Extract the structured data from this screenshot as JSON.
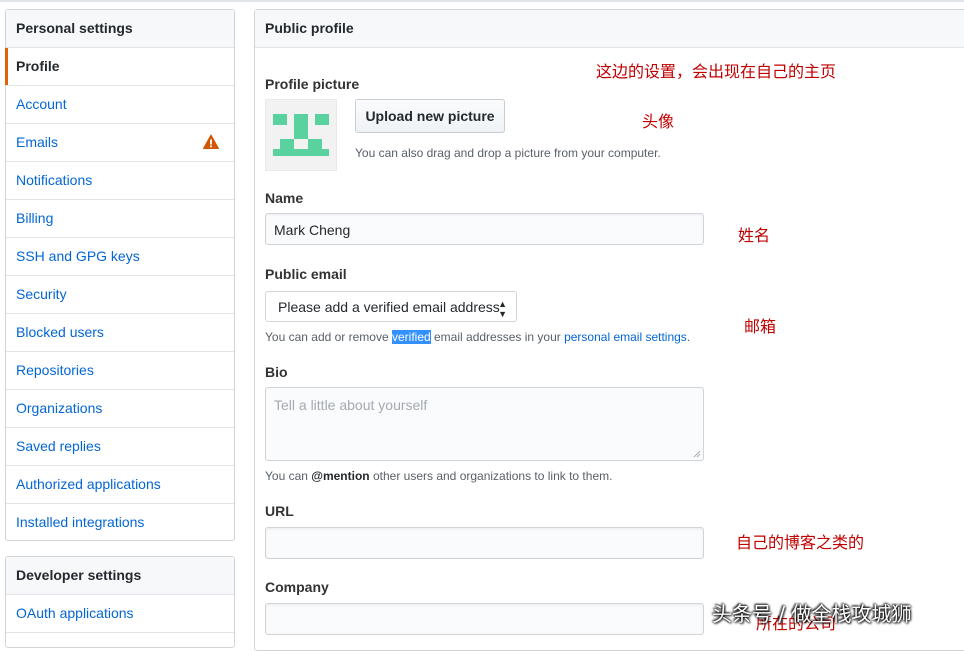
{
  "sidebar": {
    "title": "Personal settings",
    "items": [
      {
        "label": "Profile",
        "selected": true
      },
      {
        "label": "Account"
      },
      {
        "label": "Emails",
        "icon": "warning-icon"
      },
      {
        "label": "Notifications"
      },
      {
        "label": "Billing"
      },
      {
        "label": "SSH and GPG keys"
      },
      {
        "label": "Security"
      },
      {
        "label": "Blocked users"
      },
      {
        "label": "Repositories"
      },
      {
        "label": "Organizations"
      },
      {
        "label": "Saved replies"
      },
      {
        "label": "Authorized applications"
      },
      {
        "label": "Installed integrations"
      }
    ]
  },
  "developer": {
    "title": "Developer settings",
    "items": [
      {
        "label": "OAuth applications"
      }
    ]
  },
  "main": {
    "title": "Public profile",
    "picture": {
      "label": "Profile picture",
      "button": "Upload new picture",
      "note": "You can also drag and drop a picture from your computer."
    },
    "name": {
      "label": "Name",
      "value": "Mark Cheng"
    },
    "email": {
      "label": "Public email",
      "selected": "Please add a verified email address",
      "note_pre": "You can add or remove ",
      "note_hl": "verified",
      "note_mid": " email addresses in your ",
      "note_link": "personal email settings",
      "note_end": "."
    },
    "bio": {
      "label": "Bio",
      "placeholder": "Tell a little about yourself",
      "note_pre": "You can ",
      "note_bold": "@mention",
      "note_post": " other users and organizations to link to them."
    },
    "url": {
      "label": "URL",
      "value": ""
    },
    "company": {
      "label": "Company",
      "value": ""
    }
  },
  "annotations": {
    "top": "这边的设置，会出现在自己的主页",
    "avatar": "头像",
    "name": "姓名",
    "email": "邮箱",
    "url": "自己的博客之类的",
    "company": "所在的公司",
    "watermark": "头条号 / 做全栈攻城狮"
  },
  "colors": {
    "link": "#0366d6",
    "selected_bar": "#e36209",
    "warning": "#d15704",
    "annotation": "#c00000",
    "avatar": "#5ad2a0"
  }
}
